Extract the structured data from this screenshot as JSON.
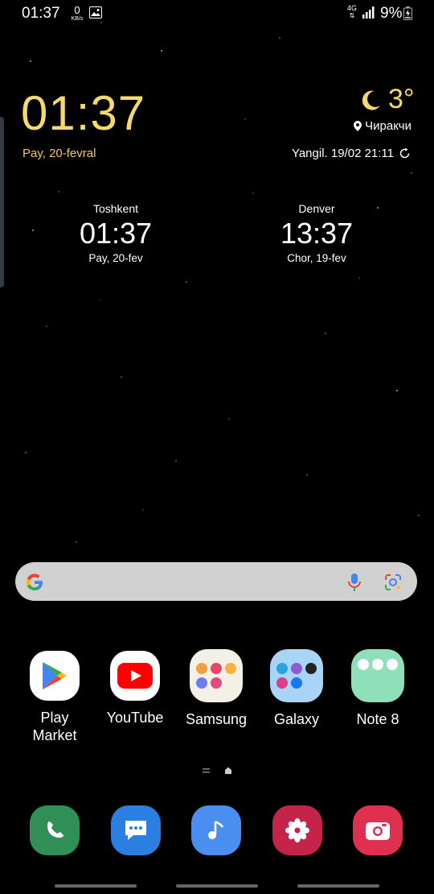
{
  "status_bar": {
    "time": "01:37",
    "net_speed_value": "0",
    "net_speed_unit": "KB/s",
    "network_type": "4G",
    "battery_percent": "9%"
  },
  "clock_widget": {
    "time": "01:37",
    "date": "Pay, 20-fevral",
    "temperature": "3°",
    "location": "Чиракчи",
    "updated": "Yangil. 19/02 21:11"
  },
  "world_clocks": [
    {
      "city": "Toshkent",
      "time": "01:37",
      "date": "Pay, 20-fev"
    },
    {
      "city": "Denver",
      "time": "13:37",
      "date": "Chor, 19-fev"
    }
  ],
  "apps": [
    {
      "label": "Play\nMarket",
      "label_line1": "Play",
      "label_line2": "Market"
    },
    {
      "label": "YouTube"
    },
    {
      "label": "Samsung"
    },
    {
      "label": "Galaxy"
    },
    {
      "label": "Note 8"
    }
  ],
  "dock": [
    "phone-icon",
    "messages-icon",
    "music-icon",
    "gallery-icon",
    "camera-icon"
  ],
  "colors": {
    "accent_yellow": "#f6d96b",
    "date_orange": "#f6c45a",
    "search_bg": "#d1d1d1",
    "phone_green": "#2f8f57",
    "messages_blue": "#2a7fe0",
    "music_blue": "#4a8ef0",
    "gallery_red": "#c4244a",
    "camera_red": "#e03050"
  }
}
